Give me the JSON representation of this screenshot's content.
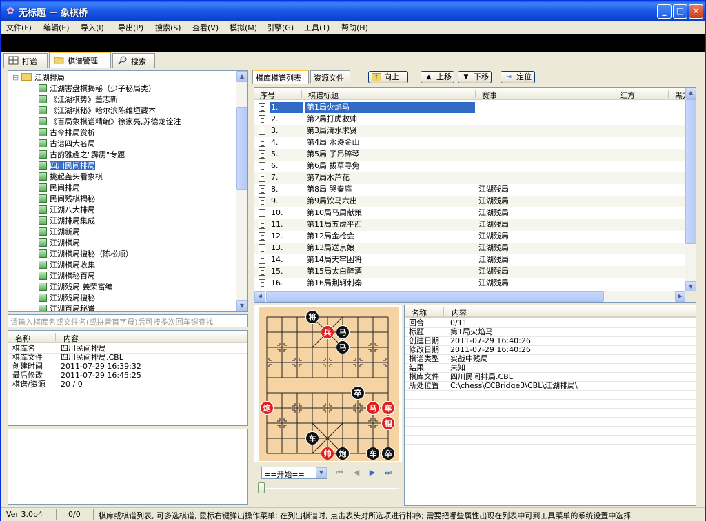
{
  "window": {
    "title": "无标题 － 象棋桥",
    "minimize": "_",
    "maximize": "□",
    "close": "✕"
  },
  "menu": [
    "文件(F)",
    "编辑(E)",
    "导入(I)",
    "导出(P)",
    "搜索(S)",
    "查看(V)",
    "模拟(M)",
    "引擎(G)",
    "工具(T)",
    "帮助(H)"
  ],
  "tabs": [
    "打谱",
    "棋谱管理",
    "搜索"
  ],
  "tree": {
    "root": "江湖排局",
    "items": [
      "江湖害盘棋揭秘（少子秘局类）",
      "《江湖棋势》董志新",
      "《江湖棋秘》哈尔滨陈维垣藏本",
      "《百局象棋谱精编》徐家亮,苏德龙诠注",
      "古今排局赏析",
      "古谱四大名局",
      "古韵雅趣之\"霹雳\"专题",
      "四川民间排局",
      "挑起盖头看象棋",
      "民间排局",
      "民间残棋揭秘",
      "江湖八大排局",
      "江湖排局集成",
      "江湖新局",
      "江湖棋局",
      "江湖棋局搜秘（陈松顺）",
      "江湖棋局收集",
      "江湖棋秘百局",
      "江湖残局  姜荣富编",
      "江湖残局搜秘",
      "江湖百局秘谱"
    ],
    "selected_index": 7
  },
  "search_placeholder": "请输入棋库名或文件名(或拼音首字母)后可按多次回车键查找",
  "props": {
    "headers": [
      "名称",
      "内容"
    ],
    "rows": [
      [
        "棋库名",
        "四川民间排局"
      ],
      [
        "棋库文件",
        "四川民间排局.CBL"
      ],
      [
        "创建时间",
        "2011-07-29 16:39:32"
      ],
      [
        "最后修改",
        "2011-07-29 16:45:25"
      ],
      [
        "棋谱/资源",
        "20 / 0"
      ]
    ]
  },
  "right_tabs": [
    "棋库棋谱列表",
    "资源文件"
  ],
  "toolbar": [
    "向上",
    "上移",
    "下移",
    "定位"
  ],
  "gamelist": {
    "headers": [
      "序号",
      "棋谱标题",
      "赛事",
      "红方",
      "黑方"
    ],
    "rows": [
      [
        "1.",
        "第1局火焰马",
        ""
      ],
      [
        "2.",
        "第2局打虎救帅",
        ""
      ],
      [
        "3.",
        "第3局滑水求贤",
        ""
      ],
      [
        "4.",
        "第4局 水漫金山",
        ""
      ],
      [
        "5.",
        "第5局 子昂碎琴",
        ""
      ],
      [
        "6.",
        "第6局 拔草寻兔",
        ""
      ],
      [
        "7.",
        "第7局水芦花",
        ""
      ],
      [
        "8.",
        "第8局 哭秦庭",
        "江湖残局"
      ],
      [
        "9.",
        "第9局饮马六出",
        "江湖残局"
      ],
      [
        "10.",
        "第10局马周献策",
        "江湖残局"
      ],
      [
        "11.",
        "第11局五虎平西",
        "江湖残局"
      ],
      [
        "12.",
        "第12局金枪会",
        "江湖残局"
      ],
      [
        "13.",
        "第13局送京娘",
        "江湖残局"
      ],
      [
        "14.",
        "第14局天牢困将",
        "江湖残局"
      ],
      [
        "15.",
        "第15局太白醉酒",
        "江湖残局"
      ],
      [
        "16.",
        "第16局荆轲刺秦",
        "江湖残局"
      ]
    ],
    "selected_index": 0
  },
  "board": {
    "pieces": [
      {
        "label": "将",
        "side": "black",
        "file": 3,
        "rank": 0
      },
      {
        "label": "兵",
        "side": "red",
        "file": 4,
        "rank": 1
      },
      {
        "label": "马",
        "side": "black",
        "file": 5,
        "rank": 1
      },
      {
        "label": "马",
        "side": "black",
        "file": 5,
        "rank": 2
      },
      {
        "label": "卒",
        "side": "black",
        "file": 6,
        "rank": 5
      },
      {
        "label": "炮",
        "side": "red",
        "file": 0,
        "rank": 6
      },
      {
        "label": "马",
        "side": "red",
        "file": 7,
        "rank": 6
      },
      {
        "label": "车",
        "side": "red",
        "file": 8,
        "rank": 6
      },
      {
        "label": "相",
        "side": "red",
        "file": 8,
        "rank": 7
      },
      {
        "label": "车",
        "side": "black",
        "file": 3,
        "rank": 8
      },
      {
        "label": "帅",
        "side": "red",
        "file": 4,
        "rank": 9
      },
      {
        "label": "炮",
        "side": "black",
        "file": 5,
        "rank": 9
      },
      {
        "label": "车",
        "side": "black",
        "file": 7,
        "rank": 9
      },
      {
        "label": "卒",
        "side": "black",
        "file": 8,
        "rank": 9
      }
    ]
  },
  "move_combo": "==开始==",
  "nav_buttons": [
    "⏮",
    "◀",
    "▶",
    "⏭"
  ],
  "info": {
    "headers": [
      "名称",
      "内容"
    ],
    "rows": [
      [
        "回合",
        "0/11"
      ],
      [
        "标题",
        "第1局火焰马"
      ],
      [
        "创建日期",
        "2011-07-29 16:40:26"
      ],
      [
        "修改日期",
        "2011-07-29 16:40:26"
      ],
      [
        "棋谱类型",
        "实战中残局"
      ],
      [
        "结果",
        "未知"
      ],
      [
        "棋库文件",
        "四川民间排局.CBL"
      ],
      [
        "所处位置",
        "C:\\chess\\CCBridge3\\CBL\\江湖排局\\"
      ]
    ]
  },
  "status": {
    "version": "Ver 3.0b4",
    "count": "0/0",
    "message": "棋库或棋谱列表, 可多选棋谱, 鼠标右键弹出操作菜单; 在列出棋谱时, 点击表头对所选项进行排序; 需要把哪些属性出现在列表中可到工具菜单的系统设置中选择"
  },
  "colors": {
    "red_piece": "#e02020",
    "black_piece": "#111111",
    "board_bg": "#f6d3a3",
    "selection": "#316ac5"
  }
}
